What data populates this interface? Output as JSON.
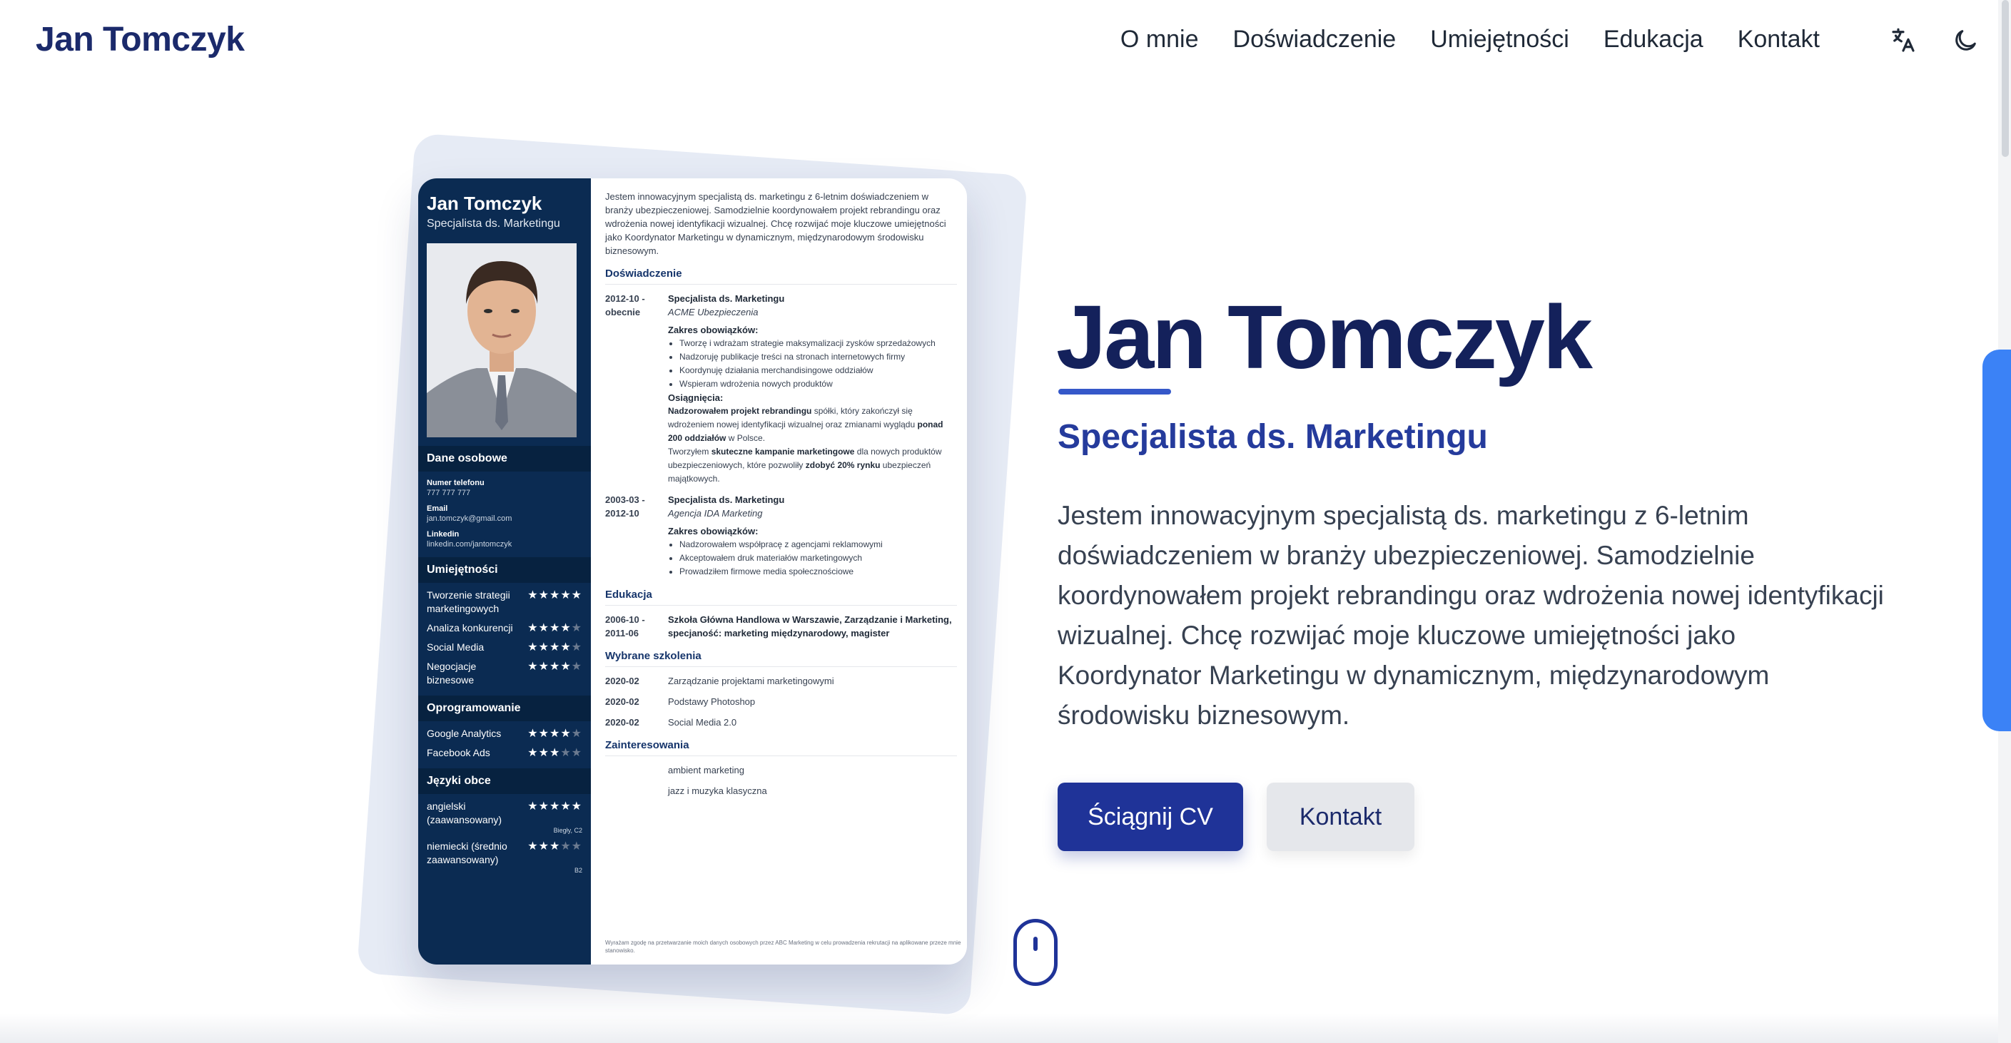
{
  "header": {
    "brand": "Jan Tomczyk",
    "nav": [
      "O mnie",
      "Doświadczenie",
      "Umiejętności",
      "Edukacja",
      "Kontakt"
    ],
    "icons": [
      "translate-icon",
      "moon-icon"
    ]
  },
  "hero": {
    "name": "Jan Tomczyk",
    "subtitle": "Specjalista ds. Marketingu",
    "description": "Jestem innowacyjnym specjalistą ds. marketingu z 6-letnim doświadczeniem w branży ubezpieczeniowej. Samodzielnie koordynowałem projekt rebrandingu oraz wdrożenia nowej identyfikacji wizualnej. Chcę rozwijać moje kluczowe umiejętności jako Koordynator Marketingu w dynamicznym, międzynarodowym środowisku biznesowym.",
    "download_button": "Ściągnij CV",
    "contact_button": "Kontakt"
  },
  "cv": {
    "name": "Jan Tomczyk",
    "role": "Specjalista ds. Marketingu",
    "personal_heading": "Dane osobowe",
    "phone_label": "Numer telefonu",
    "phone": "777 777 777",
    "email_label": "Email",
    "email": "jan.tomczyk@gmail.com",
    "linkedin_label": "Linkedin",
    "linkedin": "linkedin.com/jantomczyk",
    "skills_heading": "Umiejętności",
    "skills": [
      {
        "name": "Tworzenie strategii marketingowych",
        "rating": 5
      },
      {
        "name": "Analiza konkurencji",
        "rating": 4
      },
      {
        "name": "Social Media",
        "rating": 4
      },
      {
        "name": "Negocjacje biznesowe",
        "rating": 4
      }
    ],
    "software_heading": "Oprogramowanie",
    "software": [
      {
        "name": "Google Analytics",
        "rating": 4
      },
      {
        "name": "Facebook Ads",
        "rating": 3
      }
    ],
    "languages_heading": "Języki obce",
    "languages": [
      {
        "name": "angielski (zaawansowany)",
        "rating": 5,
        "level": "Biegły, C2"
      },
      {
        "name": "niemiecki (średnio zaawansowany)",
        "rating": 3,
        "level": "B2"
      }
    ],
    "intro": "Jestem innowacyjnym specjalistą ds. marketingu z 6-letnim doświadczeniem w branży ubezpieczeniowej. Samodzielnie koordynowałem projekt rebrandingu oraz wdrożenia nowej identyfikacji wizualnej. Chcę rozwijać moje kluczowe umiejętności jako Koordynator Marketingu w dynamicznym, międzynarodowym środowisku biznesowym.",
    "experience_heading": "Doświadczenie",
    "job1": {
      "date": "2012-10 - obecnie",
      "title": "Specjalista ds. Marketingu",
      "company": "ACME Ubezpieczenia",
      "duties_label": "Zakres obowiązków:",
      "duties": [
        "Tworzę i wdrażam strategie maksymalizacji zysków sprzedażowych",
        "Nadzoruję publikacje treści na stronach internetowych firmy",
        "Koordynuję działania merchandisingowe oddziałów",
        "Wspieram wdrożenia nowych produktów"
      ],
      "achievements_label": "Osiągnięcia:",
      "achievement1_bold": "Nadzorowałem projekt rebrandingu",
      "achievement1_a": " spółki, który zakończył się wdrożeniem nowej identyfikacji wizualnej oraz zmianami wyglądu ",
      "achievement1_bold2": "ponad 200 oddziałów",
      "achievement1_b": " w Polsce.",
      "achievement2_a": "Tworzyłem ",
      "achievement2_bold": "skuteczne kampanie marketingowe",
      "achievement2_b": " dla nowych produktów ubezpieczeniowych, które pozwoliły ",
      "achievement2_bold2": "zdobyć 20% rynku",
      "achievement2_c": " ubezpieczeń majątkowych."
    },
    "job2": {
      "date": "2003-03 - 2012-10",
      "title": "Specjalista ds. Marketingu",
      "company": "Agencja IDA Marketing",
      "duties_label": "Zakres obowiązków:",
      "duties": [
        "Nadzorowałem współpracę z agencjami reklamowymi",
        "Akceptowałem druk materiałów marketingowych",
        "Prowadziłem firmowe media społecznościowe"
      ]
    },
    "education_heading": "Edukacja",
    "education": {
      "date": "2006-10 - 2011-06",
      "text": "Szkoła Główna Handlowa w Warszawie, Zarządzanie i Marketing, specjaność: marketing międzynarodowy, magister"
    },
    "training_heading": "Wybrane szkolenia",
    "trainings": [
      {
        "date": "2020-02",
        "name": "Zarządzanie projektami marketingowymi"
      },
      {
        "date": "2020-02",
        "name": "Podstawy Photoshop"
      },
      {
        "date": "2020-02",
        "name": "Social Media 2.0"
      }
    ],
    "interests_heading": "Zainteresowania",
    "interests": [
      "ambient marketing",
      "jazz i muzyka klasyczna"
    ],
    "footer": "Wyrażam zgodę na przetwarzanie moich danych osobowych przez ABC Marketing w celu prowadzenia rekrutacji na aplikowane przeze mnie stanowisko."
  },
  "colors": {
    "brand": "#1b2a6b",
    "accent": "#1f3398",
    "cv_sidebar": "#0b2b52",
    "side_tab": "#3b82f6"
  }
}
